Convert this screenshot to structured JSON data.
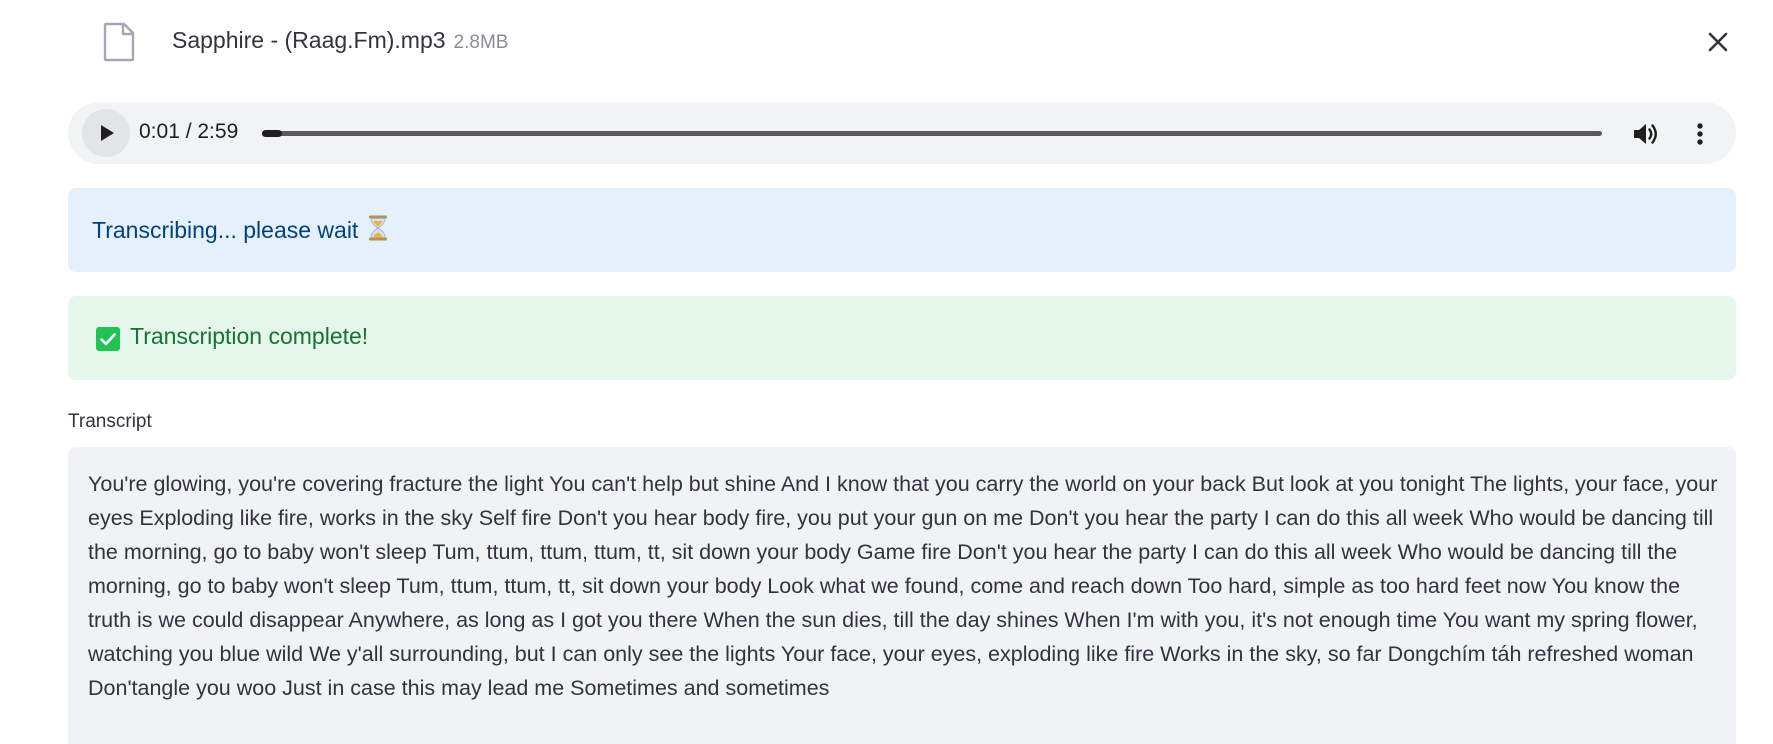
{
  "file": {
    "name": "Sapphire - (Raag.Fm).mp3",
    "size": "2.8MB",
    "icon": "file-icon",
    "close_icon": "close-icon"
  },
  "audio": {
    "time": "0:01 / 2:59",
    "progress_fraction": 0.0056,
    "icons": [
      "play-icon",
      "volume-icon",
      "more-vertical-icon"
    ]
  },
  "alerts": {
    "info_text": "Transcribing... please wait",
    "info_icon": "hourglass-icon",
    "success_text": "Transcription complete!",
    "success_icon": "check-box-icon"
  },
  "transcript": {
    "label": "Transcript",
    "value": " You're glowing, you're covering fracture the light You can't help but shine And I know that you carry the world on your back But look at you tonight The lights, your face, your eyes Exploding like fire, works in the sky Self fire Don't you hear body fire, you put your gun on me Don't you hear the party I can do this all week Who would be dancing till the morning, go to baby won't sleep Tum, ttum, ttum, ttum, tt, sit down your body Game fire Don't you hear the party I can do this all week Who would be dancing till the morning, go to baby won't sleep Tum, ttum, ttum, tt, sit down your body Look what we found, come and reach down Too hard, simple as too hard feet now You know the truth is we could disappear Anywhere, as long as I got you there When the sun dies, till the day shines When I'm with you, it's not enough time You want my spring flower, watching you blue wild We y'all surrounding, but I can only see the lights Your face, your eyes, exploding like fire Works in the sky, so far Dongchím táh refreshed woman Don'tangle you woo Just in case this may lead me Sometimes and sometimes"
  },
  "colors": {
    "info_bg": "#e6f0fb",
    "info_text": "#004280",
    "success_bg": "#e5f7ea",
    "success_text": "#177233",
    "success_check": "#21c354",
    "player_bg": "#f1f3f4",
    "transcript_bg": "#f0f2f6"
  }
}
